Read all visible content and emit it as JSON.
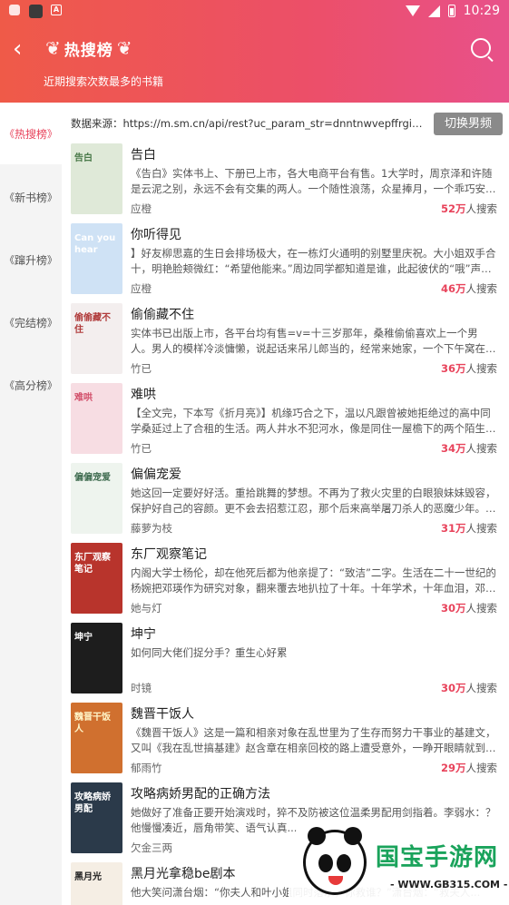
{
  "status_bar": {
    "time": "10:29",
    "a_icon_label": "A"
  },
  "header": {
    "title": "热搜榜",
    "subtitle": "近期搜索次数最多的书籍"
  },
  "sidebar": {
    "items": [
      {
        "label": "热搜榜",
        "active": true
      },
      {
        "label": "新书榜",
        "active": false
      },
      {
        "label": "蹿升榜",
        "active": false
      },
      {
        "label": "完结榜",
        "active": false
      },
      {
        "label": "高分榜",
        "active": false
      }
    ]
  },
  "source": {
    "text": "数据来源：https://m.sm.cn/api/rest?uc_param_str=dnntnwvepffrgibijbprsvd...",
    "switch_label": "切换男频"
  },
  "books": [
    {
      "title": "告白",
      "desc": "《告白》实体书上、下册已上市，各大电商平台有售。1大学时，周京泽和许随是云泥之别，永远不会有交集的两人。一个随性浪荡，众星捧月，一个乖巧安静...",
      "author": "应橙",
      "num": "52万",
      "suffix": "人搜索",
      "cover_text": "告白",
      "cover_bg": "#dfe9d8",
      "cover_fg": "#4a7a4a"
    },
    {
      "title": "你听得见",
      "desc": "】好友柳思嘉的生日会排场极大，在一栋灯火通明的别墅里庆祝。大小姐双手合十，明艳脸颊微红：“希望他能来。”周边同学都知道是谁，此起彼伏的“哦”声响...",
      "author": "应橙",
      "num": "46万",
      "suffix": "人搜索",
      "cover_text": "Can you hear",
      "cover_bg": "#cfe2f5",
      "cover_fg": "#ffffff"
    },
    {
      "title": "偷偷藏不住",
      "desc": "实体书已出版上市，各平台均有售=v=十三岁那年，桑稚偷偷喜欢上一个男人。男人的模样冷淡慵懒，说起话来吊儿郎当的，经常来她家，一个下午窝在她哥哥房...",
      "author": "竹已",
      "num": "36万",
      "suffix": "人搜索",
      "cover_text": "偷偷藏不住",
      "cover_bg": "#f3eeee",
      "cover_fg": "#b03a3a"
    },
    {
      "title": "难哄",
      "desc": "【全文完，下本写《折月亮》】机缘巧合之下，温以凡跟曾被她拒绝过的高中同学桑延过上了合租的生活。两人井水不犯河水，像是同住一屋檐下的两个陌生人...",
      "author": "竹已",
      "num": "34万",
      "suffix": "人搜索",
      "cover_text": "难哄",
      "cover_bg": "#f7dde3",
      "cover_fg": "#d24f6a"
    },
    {
      "title": "偏偏宠爱",
      "desc": "她这回一定要好好活。重拾跳舞的梦想。不再为了救火灾里的白眼狼妹妹毁容，保护好自己的容颜。更不会去招惹江忍，那个后来高举屠刀杀人的恶魔少年。然...",
      "author": "藤萝为枝",
      "num": "31万",
      "suffix": "人搜索",
      "cover_text": "偏偏宠爱",
      "cover_bg": "#eef4ee",
      "cover_fg": "#3e6b4f"
    },
    {
      "title": "东厂观察笔记",
      "desc": "内阁大学士杨伦，却在他死后都为他亲提了：“致洁”二字。生活在二十一世纪的杨婉把邓瑛作为研究对象，翻来覆去地扒拉了十年。十年学术，十年血泪，邓瑛是...",
      "author": "她与灯",
      "num": "30万",
      "suffix": "人搜索",
      "cover_text": "东厂观察笔记",
      "cover_bg": "#b8342c",
      "cover_fg": "#ffffff"
    },
    {
      "title": "坤宁",
      "desc": "如何同大佬们捉分手？重生心好累",
      "author": "时镜",
      "num": "30万",
      "suffix": "人搜索",
      "cover_text": "坤宁",
      "cover_bg": "#1d1d1d",
      "cover_fg": "#ffffff"
    },
    {
      "title": "魏晋干饭人",
      "desc": "《魏晋干饭人》这是一篇和相亲对象在乱世里为了生存而努力干事业的基建文，又叫《我在乱世搞基建》赵含章在相亲回校的路上遭受意外，一睁开眼睛就到了...",
      "author": "郁雨竹",
      "num": "29万",
      "suffix": "人搜索",
      "cover_text": "魏晋干饭人",
      "cover_bg": "#d0702f",
      "cover_fg": "#fff5c8"
    },
    {
      "title": "攻略病娇男配的正确方法",
      "desc": "她做好了准备正要开始演戏时，猝不及防被这位温柔男配用剑指着。李弱水：？他慢慢凑近，唇角带笑、语气认真...",
      "author": "欠金三两",
      "num": "",
      "suffix": "",
      "cover_text": "攻略病娇男配",
      "cover_bg": "#2b3a4a",
      "cover_fg": "#ffffff"
    },
    {
      "title": "黑月光拿稳be剧本",
      "desc": "他大笑问潇台烟：“你夫人和叶小姐同时落水，你救谁？”潇台烟：“救夫人...",
      "author": "",
      "num": "",
      "suffix": "",
      "cover_text": "黑月光",
      "cover_bg": "#f5eee4",
      "cover_fg": "#222222"
    }
  ],
  "watermark": {
    "brand": "国宝手游网",
    "url": "- WWW.GB315.COM -"
  },
  "colors": {
    "accent": "#e8435b",
    "header_start": "#ef5a48",
    "header_end": "#e8518a"
  }
}
